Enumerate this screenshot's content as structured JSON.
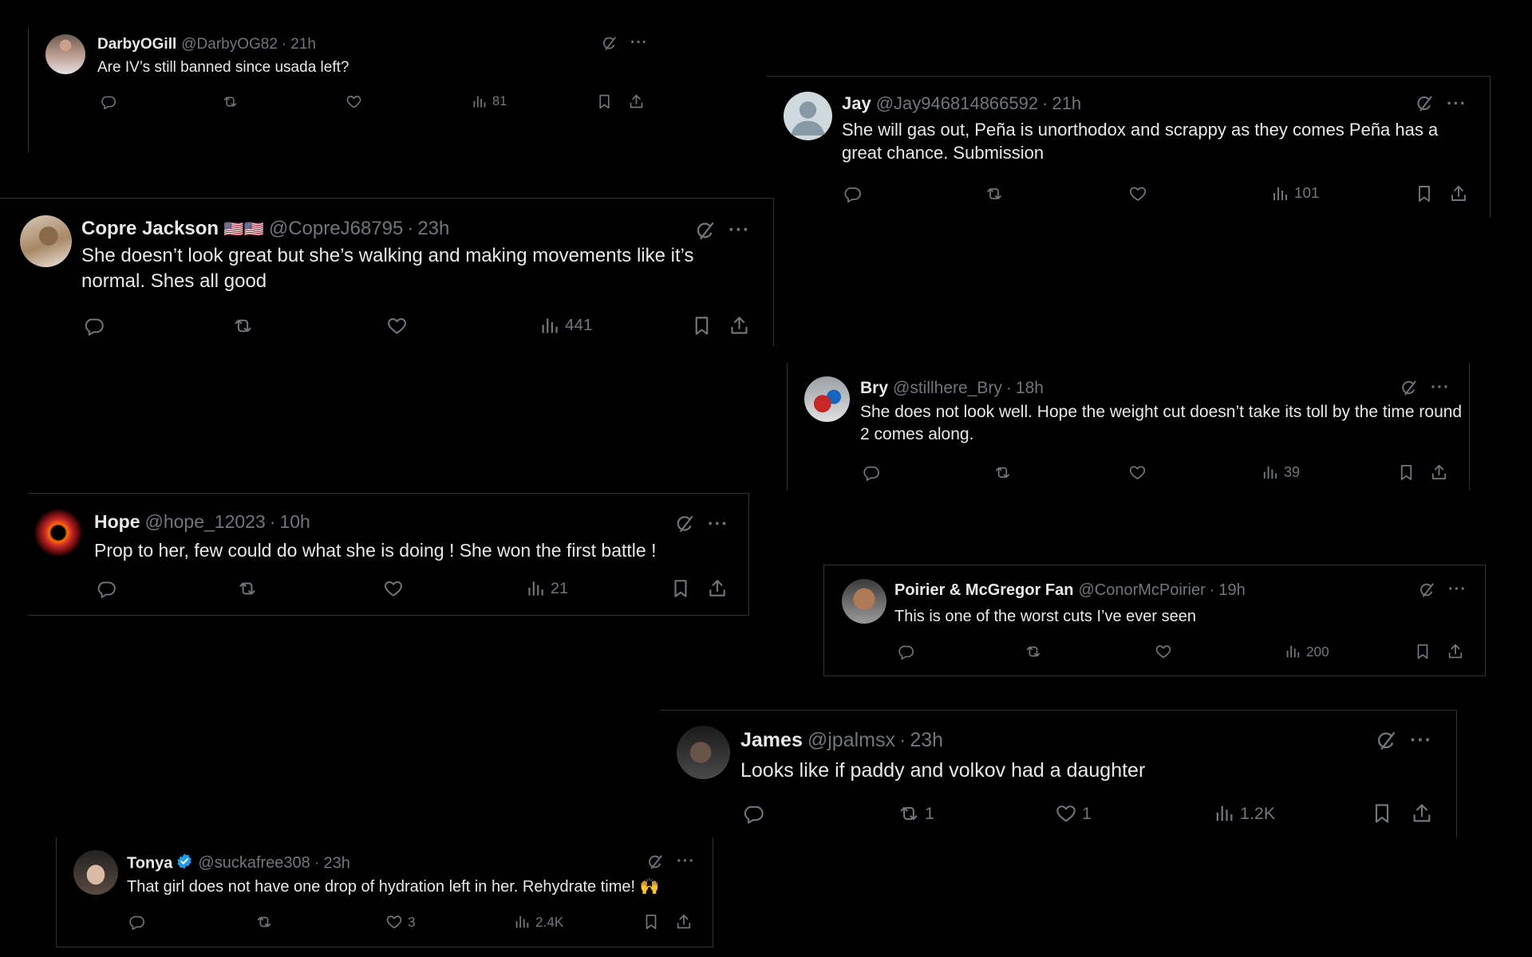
{
  "tweets": [
    {
      "id": "darby",
      "name": "DarbyOGill",
      "handle": "@DarbyOG82",
      "time": "21h",
      "text": "Are IV’s still banned since usada left?",
      "views": "81"
    },
    {
      "id": "jay",
      "name": "Jay",
      "handle": "@Jay946814866592",
      "time": "21h",
      "text": "She will gas out, Peña is unorthodox and scrappy as they comes Peña has a great chance. Submission",
      "views": "101"
    },
    {
      "id": "copre",
      "name": "Copre Jackson",
      "flags": "🇺🇸🇺🇸",
      "handle": "@CopreJ68795",
      "time": "23h",
      "text": "She doesn’t look great but she’s walking and making movements like it’s normal. Shes all good",
      "views": "441"
    },
    {
      "id": "bry",
      "name": "Bry",
      "handle": "@stillhere_Bry",
      "time": "18h",
      "text": "She does not look well. Hope the weight cut doesn’t take its toll by the time round 2 comes along.",
      "views": "39"
    },
    {
      "id": "hope",
      "name": "Hope",
      "handle": "@hope_12023",
      "time": "10h",
      "text": "Prop to her, few could do what she is doing ! She won the first battle !",
      "views": "21"
    },
    {
      "id": "poirier",
      "name": "Poirier & McGregor Fan",
      "handle": "@ConorMcPoirier",
      "time": "19h",
      "text": "This is one of the worst cuts I’ve ever seen",
      "views": "200"
    },
    {
      "id": "james",
      "name": "James",
      "handle": "@jpalmsx",
      "time": "23h",
      "text": "Looks like if paddy and volkov had a daughter",
      "reposts": "1",
      "likes": "1",
      "views": "1.2K"
    },
    {
      "id": "tonya",
      "name": "Tonya",
      "handle": "@suckafree308",
      "time": "23h",
      "text": "That girl does not have one drop of hydration left in her.  Rehydrate time! 🙌",
      "likes": "3",
      "views": "2.4K"
    }
  ],
  "separator": "·",
  "more_glyph": "···",
  "icons": {
    "reply": "reply-icon",
    "repost": "repost-icon",
    "like": "like-icon",
    "views": "views-icon",
    "bookmark": "bookmark-icon",
    "share": "share-icon",
    "grok": "grok-icon",
    "more": "more-icon",
    "verified": "verified-badge-icon"
  },
  "colors": {
    "background": "#000000",
    "text": "#e7e9ea",
    "muted": "#71767b",
    "border": "#2f3336",
    "verified": "#1d9bf0"
  }
}
